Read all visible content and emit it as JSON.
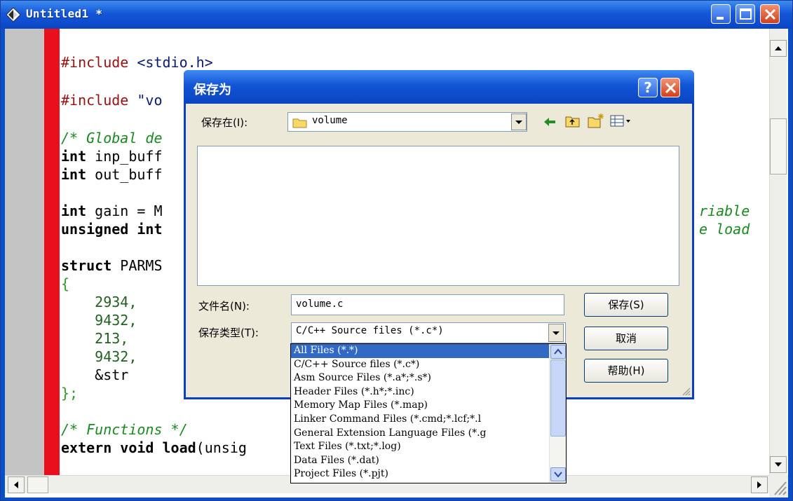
{
  "window": {
    "title": "Untitled1 *"
  },
  "code_lines": [
    {
      "parts": [
        {
          "t": "#include ",
          "c": "pp"
        },
        {
          "t": "<stdio.h>",
          "c": "str"
        }
      ]
    },
    {
      "parts": [
        {
          "t": "#include ",
          "c": "pp"
        },
        {
          "t": "\"vo",
          "c": "str"
        }
      ]
    },
    {
      "parts": [
        {
          "t": "/* Global de",
          "c": "cm"
        }
      ]
    },
    {
      "parts": [
        {
          "t": "int",
          "c": "kw"
        },
        {
          "t": " inp_buff",
          "c": ""
        }
      ]
    },
    {
      "parts": [
        {
          "t": "int",
          "c": "kw"
        },
        {
          "t": " out_buff",
          "c": ""
        }
      ]
    },
    {
      "parts": [
        {
          "t": "int",
          "c": "kw"
        },
        {
          "t": " gain = M",
          "c": ""
        }
      ]
    },
    {
      "parts": [
        {
          "t": "unsigned int",
          "c": "kw"
        }
      ]
    },
    {
      "parts": [
        {
          "t": "struct",
          "c": "kw"
        },
        {
          "t": " PARMS",
          "c": ""
        }
      ]
    },
    {
      "parts": [
        {
          "t": "{",
          "c": "brc"
        }
      ]
    },
    {
      "parts": [
        {
          "t": "    2934,",
          "c": "num"
        }
      ]
    },
    {
      "parts": [
        {
          "t": "    9432,",
          "c": "num"
        }
      ]
    },
    {
      "parts": [
        {
          "t": "    213,",
          "c": "num"
        }
      ]
    },
    {
      "parts": [
        {
          "t": "    9432,",
          "c": "num"
        }
      ]
    },
    {
      "parts": [
        {
          "t": "    &str",
          "c": ""
        }
      ]
    },
    {
      "parts": [
        {
          "t": "};",
          "c": "brc"
        }
      ]
    },
    {
      "parts": [
        {
          "t": "/* Functions */",
          "c": "cm"
        }
      ]
    },
    {
      "parts": [
        {
          "t": "extern void",
          "c": "kw"
        },
        {
          "t": " ",
          "c": ""
        },
        {
          "t": "load",
          "c": "kw"
        },
        {
          "t": "(unsig",
          "c": ""
        }
      ]
    }
  ],
  "code_right": {
    "line1": "riable",
    "line2": "e load"
  },
  "dialog": {
    "title": "保存为",
    "help_glyph": "?",
    "save_in_label": "保存在(I):",
    "save_in_value": "volume",
    "filename_label": "文件名(N):",
    "filename_value": "volume.c",
    "filetype_label": "保存类型(T):",
    "filetype_value": "C/C++ Source files (*.c*)",
    "save_button": "保存(S)",
    "cancel_button": "取消",
    "help_button": "帮助(H)"
  },
  "filetype_options": [
    "All Files (*.*)",
    "C/C++ Source files (*.c*)",
    "Asm Source Files (*.a*;*.s*)",
    "Header Files (*.h*;*.inc)",
    "Memory Map Files (*.map)",
    "Linker Command Files (*.cmd;*.lcf;*.l",
    "General Extension Language Files (*.g",
    "Text Files (*.txt;*.log)",
    "Data Files (*.dat)",
    "Project Files (*.pjt)"
  ],
  "filetype_selected_index": 0,
  "colors": {
    "title_blue": "#0b46c4",
    "selection": "#316ac5",
    "red_margin": "#e8101c",
    "comment": "#1a8a20"
  },
  "icons": [
    "app-icon",
    "minimize-icon",
    "maximize-icon",
    "close-icon",
    "help-icon",
    "folder-icon",
    "back-arrow-icon",
    "up-folder-icon",
    "new-folder-icon",
    "view-menu-icon",
    "dropdown-arrow-icon",
    "scroll-up-icon",
    "scroll-down-icon",
    "scroll-left-icon",
    "scroll-right-icon",
    "resize-grip-icon"
  ]
}
